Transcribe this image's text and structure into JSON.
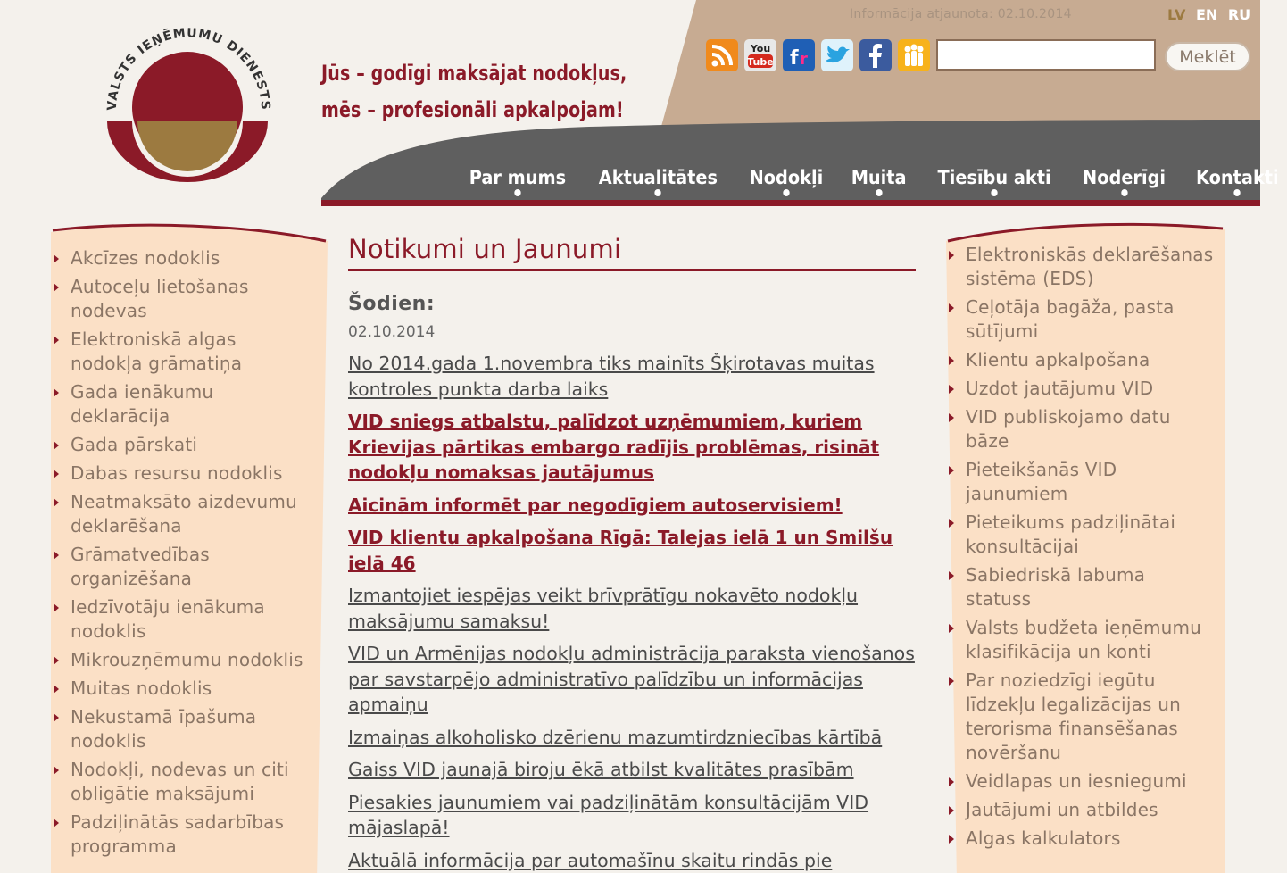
{
  "header": {
    "logo_text": "VALSTS IEŅĒMUMU DIENESTS",
    "slogan_lines": [
      "Jūs – godīgi maksājat nodokļus,",
      "mēs – profesionāli apkalpojam!"
    ],
    "info_updated": "Informācija atjaunota: 02.10.2014",
    "languages": [
      {
        "label": "LV",
        "active": true
      },
      {
        "label": "EN",
        "active": false
      },
      {
        "label": "RU",
        "active": false
      }
    ],
    "social_icons": [
      "rss-icon",
      "youtube-icon",
      "flickr-icon",
      "twitter-icon",
      "facebook-icon",
      "draugiem-icon"
    ],
    "search": {
      "value": "",
      "placeholder": "",
      "button_label": "Meklēt"
    },
    "nav": [
      "Par mums",
      "Aktualitātes",
      "Nodokļi",
      "Muita",
      "Tiesību akti",
      "Noderīgi",
      "Kontakti"
    ]
  },
  "left_sidebar": {
    "items": [
      "Akcīzes nodoklis",
      "Autoceļu lietošanas nodevas",
      "Elektroniskā algas nodokļa grāmatiņa",
      "Gada ienākumu deklarācija",
      "Gada pārskati",
      "Dabas resursu nodoklis",
      "Neatmaksāto aizdevumu deklarēšana",
      "Grāmatvedības organizēšana",
      "Iedzīvotāju ienākuma nodoklis",
      "Mikrouzņēmumu nodoklis",
      "Muitas nodoklis",
      "Nekustamā īpašuma nodoklis",
      "Nodokļi, nodevas un citi obligātie maksājumi",
      "Padziļinātās sadarbības programma"
    ]
  },
  "main": {
    "title": "Notikumi un Jaunumi",
    "today_label": "Šodien:",
    "today_date": "02.10.2014",
    "news": [
      {
        "text": "No 2014.gada 1.novembra tiks mainīts Šķirotavas muitas kontroles punkta darba laiks",
        "highlight": false
      },
      {
        "text": "VID sniegs atbalstu, palīdzot uzņēmumiem, kuriem Krievijas pārtikas embargo radījis problēmas, risināt nodokļu nomaksas jautājumus",
        "highlight": true
      },
      {
        "text": "Aicinām informēt par negodīgiem autoservisiem!",
        "highlight": true
      },
      {
        "text": "VID klientu apkalpošana Rīgā: Talejas ielā 1 un Smilšu ielā 46",
        "highlight": true
      },
      {
        "text": "Izmantojiet iespējas veikt brīvprātīgu nokavēto nodokļu maksājumu samaksu!",
        "highlight": false
      },
      {
        "text": "VID un Armēnijas nodokļu administrācija paraksta vienošanos par savstarpējo administratīvo palīdzību un informācijas apmaiņu",
        "highlight": false
      },
      {
        "text": "Izmaiņas alkoholisko dzērienu mazumtirdzniecības kārtībā",
        "highlight": false
      },
      {
        "text": "Gaiss VID jaunajā biroju ēkā atbilst kvalitātes prasībām",
        "highlight": false
      },
      {
        "text": "Piesakies jaunumiem vai padziļinātām konsultācijām VID mājaslapā!",
        "highlight": false
      },
      {
        "text": "Aktuālā informācija par automašīnu skaitu rindās pie",
        "highlight": false
      }
    ]
  },
  "right_sidebar": {
    "items": [
      "Elektroniskās deklarēšanas sistēma (EDS)",
      "Ceļotāja bagāža, pasta sūtījumi",
      "Klientu apkalpošana",
      "Uzdot jautājumu VID",
      "VID publiskojamo datu bāze",
      "Pieteikšanās VID jaunumiem",
      "Pieteikums padziļinātai konsultācijai",
      "Sabiedriskā labuma statuss",
      "Valsts budžeta ieņēmumu klasifikācija un konti",
      "Par noziedzīgi iegūtu līdzekļu legalizācijas un terorisma finansēšanas novēršanu",
      "Veidlapas un iesniegumi",
      "Jautājumi un atbildes",
      "Algas kalkulators"
    ]
  },
  "colors": {
    "brand_red": "#8b1a28",
    "header_tan": "#c7ab92",
    "nav_gray": "#5f5f5f",
    "sidebar_bg": "#fbe0c6"
  }
}
